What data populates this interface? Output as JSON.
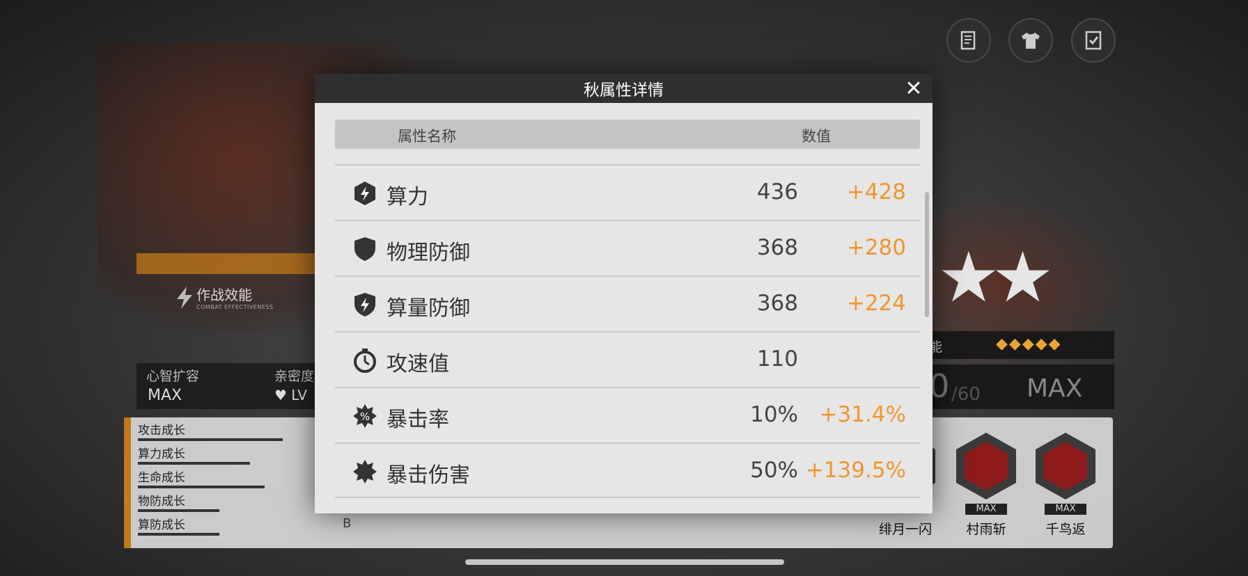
{
  "background": {
    "combat_effectiveness": {
      "title": "作战效能",
      "subtitle": "COMBAT EFFECTIVENESS"
    },
    "mind_expansion": {
      "label": "心智扩容",
      "value": "MAX"
    },
    "intimacy": {
      "label": "亲密度",
      "value": "LV"
    },
    "growth": [
      {
        "label": "攻击成长",
        "fill": 0.8
      },
      {
        "label": "算力成长",
        "fill": 0.62
      },
      {
        "label": "生命成长",
        "fill": 0.7
      },
      {
        "label": "物防成长",
        "fill": 0.45
      },
      {
        "label": "算防成长",
        "fill": 0.45
      }
    ],
    "growth_grade": "B",
    "skill_level": {
      "label": "能",
      "current": "0",
      "max": "/60",
      "status": "MAX"
    },
    "skills": [
      {
        "name": "绯月一闪",
        "badge": ""
      },
      {
        "name": "村雨斩",
        "badge": "MAX"
      },
      {
        "name": "千鸟返",
        "badge": "MAX"
      }
    ],
    "top_buttons": [
      "document-icon",
      "outfit-icon",
      "checklist-icon"
    ]
  },
  "modal": {
    "title": "秋属性详情",
    "close_icon": "close-icon",
    "headers": {
      "name": "属性名称",
      "value": "数值"
    },
    "rows": [
      {
        "icon": "hash-power-icon",
        "name": "算力",
        "base": "436",
        "bonus": "+428"
      },
      {
        "icon": "shield-icon",
        "name": "物理防御",
        "base": "368",
        "bonus": "+280"
      },
      {
        "icon": "hash-defense-icon",
        "name": "算量防御",
        "base": "368",
        "bonus": "+224"
      },
      {
        "icon": "stopwatch-icon",
        "name": "攻速值",
        "base": "110",
        "bonus": ""
      },
      {
        "icon": "crit-rate-icon",
        "name": "暴击率",
        "base": "10%",
        "bonus": "+31.4%"
      },
      {
        "icon": "crit-damage-icon",
        "name": "暴击伤害",
        "base": "50%",
        "bonus": "+139.5%"
      }
    ]
  },
  "colors": {
    "bonus": "#f0962e",
    "header_bg": "#2f2f2f",
    "panel_bg": "#e6e6e6",
    "accent": "#c47a1a"
  }
}
